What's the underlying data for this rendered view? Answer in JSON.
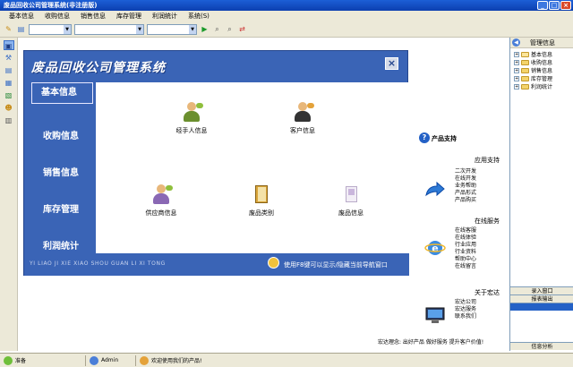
{
  "window": {
    "title": "废品回收公司管理系统(非注册版)",
    "minimize": "_",
    "maximize": "□",
    "close": "×"
  },
  "menu": [
    "基本信息",
    "收购信息",
    "销售信息",
    "库存管理",
    "利润统计",
    "系统(S)"
  ],
  "toolbar": {
    "icons": [
      "pencil-icon",
      "document-icon",
      "play-icon",
      "search-icon",
      "search-next-icon",
      "export-icon"
    ]
  },
  "panel": {
    "title": "废品回收公司管理系统",
    "close": "×",
    "nav": [
      "基本信息",
      "收购信息",
      "销售信息",
      "库存管理",
      "利润统计"
    ],
    "tiles": [
      {
        "label": "经手人信息",
        "icon": "handler-person-icon"
      },
      {
        "label": "客户信息",
        "icon": "customer-person-icon"
      },
      {
        "label": "供应商信息",
        "icon": "supplier-person-icon"
      },
      {
        "label": "废品类别",
        "icon": "category-book-icon"
      },
      {
        "label": "废品信息",
        "icon": "item-info-icon"
      }
    ],
    "footer_pinyin": "YI LIAO JI XIE XIAO SHOU GUAN LI XI TONG",
    "footer_tip": "使用F8键可以显示/隐藏当前导航窗口"
  },
  "support": {
    "title": "产品支持",
    "app_support": {
      "heading": "应用支持",
      "links": [
        "二次开发",
        "在线开发",
        "业务帮助",
        "产品形式",
        "产品购买"
      ]
    },
    "online_service": {
      "heading": "在线服务",
      "links": [
        "在线客服",
        "在线体验",
        "行业应用",
        "行业资料",
        "帮助中心",
        "在线留言"
      ]
    },
    "about": {
      "heading": "关于宏达",
      "links": [
        "宏达公司",
        "宏达服务",
        "联系我们"
      ]
    },
    "footer": "宏达理念: 出好产品 做好服务 提升客户价值!"
  },
  "right_pane": {
    "title": "管理信息",
    "tree": [
      "基本信息",
      "收购信息",
      "销售信息",
      "库存管理",
      "利润统计"
    ],
    "btn_input": "录入窗口",
    "btn_report": "报表输出",
    "btn_analysis": "信息分析"
  },
  "status": {
    "ready": "准备",
    "user": "Admin",
    "welcome": "欢迎使用我们的产品!"
  }
}
